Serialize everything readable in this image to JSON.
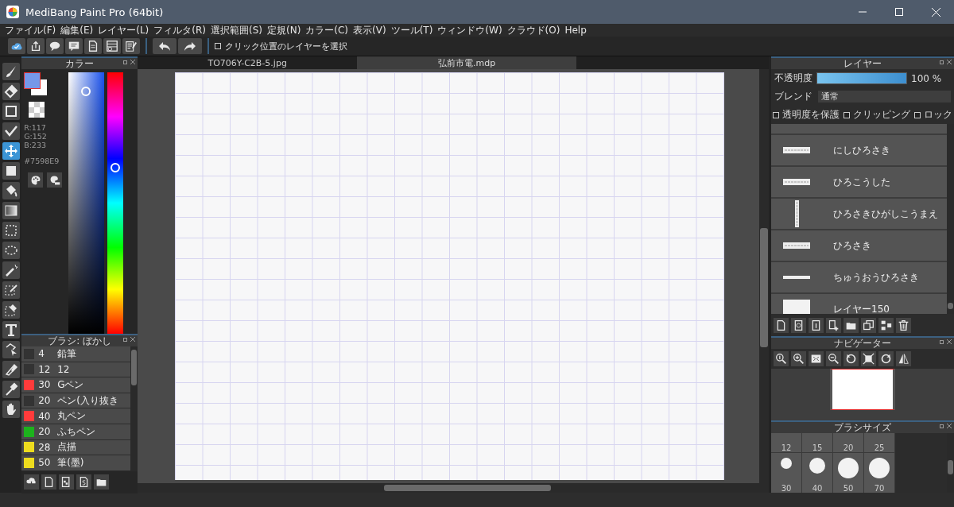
{
  "window": {
    "title": "MediBang Paint Pro (64bit)"
  },
  "menu": [
    "ファイル(F)",
    "編集(E)",
    "レイヤー(L)",
    "フィルタ(R)",
    "選択範囲(S)",
    "定規(N)",
    "カラー(C)",
    "表示(V)",
    "ツール(T)",
    "ウィンドウ(W)",
    "クラウド(O)",
    "Help"
  ],
  "toolbar": {
    "option": {
      "label": "クリック位置のレイヤーを選択",
      "checked": false
    }
  },
  "tools": [
    {
      "selected": false
    },
    {
      "selected": false
    },
    {
      "selected": false
    },
    {
      "selected": false
    },
    {
      "selected": true
    },
    {
      "selected": false
    },
    {
      "selected": false
    },
    {
      "selected": false
    },
    {
      "selected": false
    },
    {
      "selected": false
    },
    {
      "selected": false
    },
    {
      "selected": false
    },
    {
      "selected": false
    },
    {
      "selected": false
    },
    {
      "selected": false
    },
    {
      "selected": false
    },
    {
      "selected": false
    },
    {
      "selected": false
    }
  ],
  "color_panel": {
    "title": "カラー",
    "r": "R:117",
    "g": "G:152",
    "b": "B:233",
    "hex": "#7598E9",
    "hue": {
      "level": 0.64
    }
  },
  "brush_panel": {
    "title": "ブラシ: ぼかし",
    "brushes": [
      {
        "size": "4",
        "name": "鉛筆",
        "color": "#333333"
      },
      {
        "size": "12",
        "name": "12",
        "color": "#333333"
      },
      {
        "size": "30",
        "name": "Gペン",
        "color": "#ff3b3b"
      },
      {
        "size": "20",
        "name": "ペン(入り抜き",
        "color": "#333333"
      },
      {
        "size": "40",
        "name": "丸ペン",
        "color": "#ff3b3b"
      },
      {
        "size": "20",
        "name": "ふちペン",
        "color": "#1db21d"
      },
      {
        "size": "28",
        "name": "点描",
        "color": "#eedc1e"
      },
      {
        "size": "50",
        "name": "筆(墨)",
        "color": "#eedc1e"
      }
    ]
  },
  "tabs": [
    {
      "label": "TO706Y-C2B-5.jpg",
      "selected": false
    },
    {
      "label": "弘前市電.mdp",
      "selected": true
    }
  ],
  "layer_panel": {
    "title": "レイヤー",
    "opacity": {
      "label": "不透明度",
      "level": 1,
      "reading": "100 %"
    },
    "blend": {
      "label": "ブレンド",
      "value": "通常"
    },
    "options": [
      {
        "label": "透明度を保護",
        "checked": false
      },
      {
        "label": "クリッピング",
        "checked": false
      },
      {
        "label": "ロック",
        "checked": false
      }
    ],
    "layers": [
      {
        "name": "にしひろさき",
        "kind": "text"
      },
      {
        "name": "ひろこうした",
        "kind": "text"
      },
      {
        "name": "ひろさきひがしこうまえ",
        "kind": "tall"
      },
      {
        "name": "ひろさき",
        "kind": "text"
      },
      {
        "name": "ちゅうおうひろさき",
        "kind": "line"
      },
      {
        "name": "レイヤー150",
        "kind": "blank"
      }
    ]
  },
  "navigator": {
    "title": "ナビゲーター"
  },
  "brush_size_panel": {
    "title": "ブラシサイズ",
    "labels_row": [
      "12",
      "15",
      "20",
      "25"
    ],
    "sizes": [
      {
        "label": "30"
      },
      {
        "label": "40"
      },
      {
        "label": "50"
      },
      {
        "label": "70"
      }
    ]
  }
}
